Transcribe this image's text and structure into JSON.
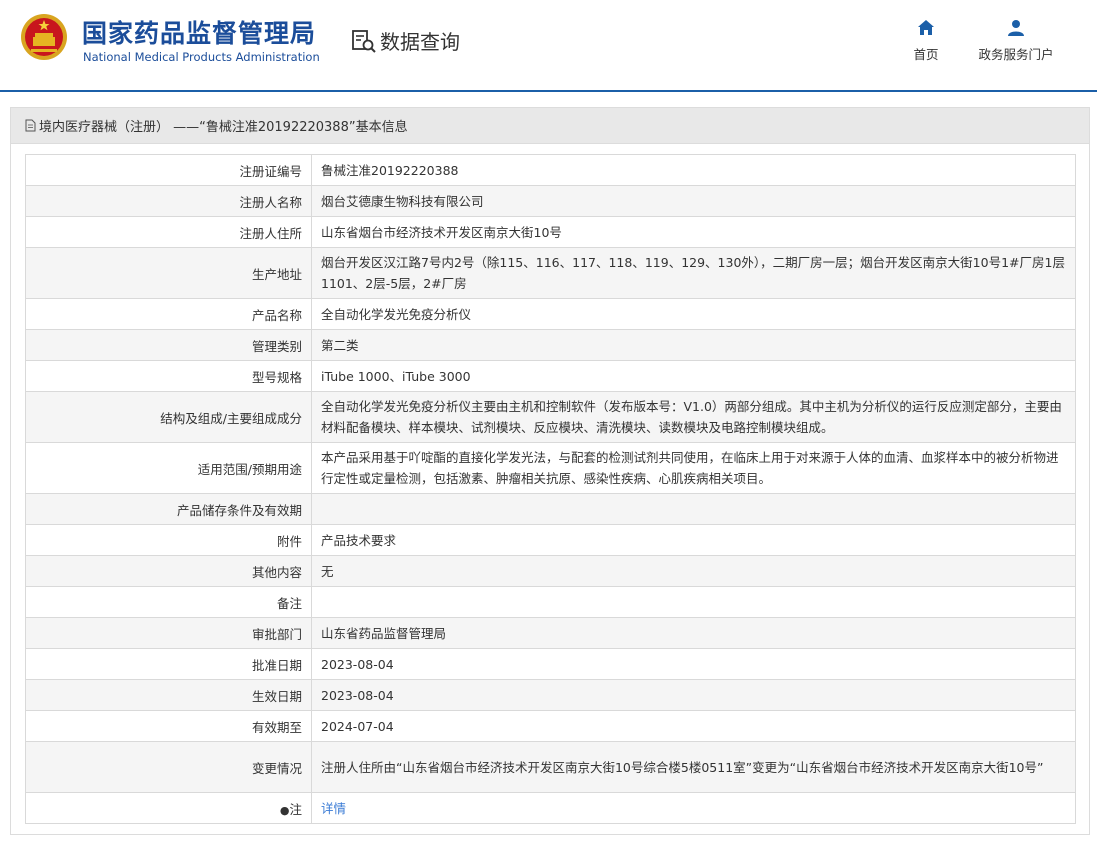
{
  "header": {
    "org_cn": "国家药品监督管理局",
    "org_en": "National Medical Products Administration",
    "query_label": "数据查询",
    "nav": [
      {
        "label": "首页",
        "icon": "home-icon"
      },
      {
        "label": "政务服务门户",
        "icon": "user-icon"
      }
    ]
  },
  "panel": {
    "title": "境内医疗器械（注册） ——“鲁械注准20192220388”基本信息"
  },
  "rows": [
    {
      "key": "注册证编号",
      "value": "鲁械注准20192220388"
    },
    {
      "key": "注册人名称",
      "value": "烟台艾德康生物科技有限公司"
    },
    {
      "key": "注册人住所",
      "value": "山东省烟台市经济技术开发区南京大街10号"
    },
    {
      "key": "生产地址",
      "value": "烟台开发区汉江路7号内2号（除115、116、117、118、119、129、130外），二期厂房一层；烟台开发区南京大街10号1#厂房1层1101、2层-5层，2#厂房"
    },
    {
      "key": "产品名称",
      "value": "全自动化学发光免疫分析仪"
    },
    {
      "key": "管理类别",
      "value": "第二类"
    },
    {
      "key": "型号规格",
      "value": "iTube 1000、iTube 3000"
    },
    {
      "key": "结构及组成/主要组成成分",
      "value": "全自动化学发光免疫分析仪主要由主机和控制软件（发布版本号：V1.0）两部分组成。其中主机为分析仪的运行反应测定部分，主要由材料配备模块、样本模块、试剂模块、反应模块、清洗模块、读数模块及电路控制模块组成。"
    },
    {
      "key": "适用范围/预期用途",
      "value": "本产品采用基于吖啶酯的直接化学发光法，与配套的检测试剂共同使用，在临床上用于对来源于人体的血清、血浆样本中的被分析物进行定性或定量检测，包括激素、肿瘤相关抗原、感染性疾病、心肌疾病相关项目。"
    },
    {
      "key": "产品储存条件及有效期",
      "value": ""
    },
    {
      "key": "附件",
      "value": "产品技术要求"
    },
    {
      "key": "其他内容",
      "value": "无"
    },
    {
      "key": "备注",
      "value": ""
    },
    {
      "key": "审批部门",
      "value": "山东省药品监督管理局"
    },
    {
      "key": "批准日期",
      "value": "2023-08-04"
    },
    {
      "key": "生效日期",
      "value": "2023-08-04"
    },
    {
      "key": "有效期至",
      "value": "2024-07-04"
    },
    {
      "key": "变更情况",
      "value": "注册人住所由“山东省烟台市经济技术开发区南京大街10号综合楼5楼0511室”变更为“山东省烟台市经济技术开发区南京大街10号”"
    }
  ],
  "note_row": {
    "key": "注",
    "icon": "bulb-icon",
    "link": "详情"
  },
  "colors": {
    "brand_blue": "#1b4d9a",
    "link_blue": "#3a7bd5",
    "panel_head_bg": "#e8e8e8"
  }
}
